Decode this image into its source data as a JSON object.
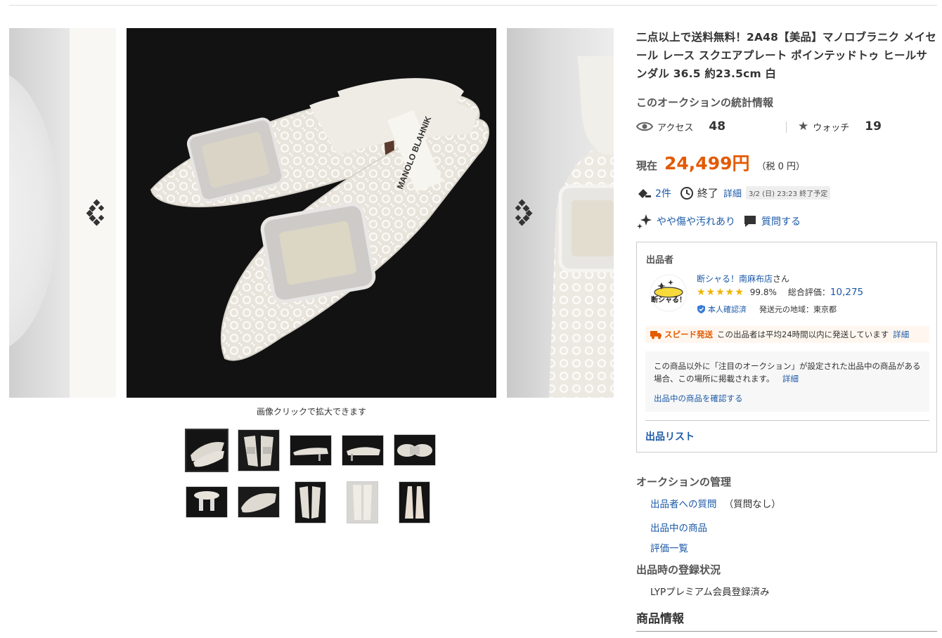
{
  "gallery": {
    "caption": "画像クリックで拡大できます",
    "prev_icon": "double-chevron-left-icon",
    "next_icon": "double-chevron-right-icon",
    "main_logo": "MANOLO BLAHNIK",
    "thumbnail_count": 10
  },
  "item": {
    "title": "二点以上で送料無料！2A48【美品】マノロブラニク メイセール レース スクエアプレート ポインテッドトゥ ヒールサンダル 36.5 約23.5cm 白"
  },
  "stats": {
    "heading": "このオークションの統計情報",
    "access_label": "アクセス",
    "access_value": "48",
    "watch_label": "ウォッチ",
    "watch_value": "19"
  },
  "price": {
    "label": "現在",
    "value": "24,499円",
    "tax": "（税 0 円）"
  },
  "bids": {
    "count": "2件",
    "end_label": "終了",
    "detail_link": "詳細",
    "end_time": "3/2 (日) 23:23 終了予定"
  },
  "condition": {
    "label": "やや傷や汚れあり",
    "question_link": "質問する"
  },
  "seller": {
    "heading": "出品者",
    "logo_text": "断シャる！",
    "name": "断シャる！南麻布店",
    "name_suffix": "さん",
    "stars": "★★★★★",
    "rating_pct": "99.8%",
    "total_label": "総合評価：",
    "total_value": "10,275",
    "verified": "本人確認済",
    "region": "発送元の地域：東京都",
    "speed_label": "スピード発送",
    "speed_text": "この出品者は平均24時間以内に発送しています",
    "speed_detail": "詳細",
    "notice_text": "この商品以外に「注目のオークション」が設定された出品中の商品がある場合、この場所に掲載されます。",
    "notice_detail": "詳細",
    "notice_confirm": "出品中の商品を確認する",
    "list_link": "出品リスト"
  },
  "management": {
    "heading": "オークションの管理",
    "question_link": "出品者への質問",
    "question_status": "（質問なし）",
    "listing_link": "出品中の商品",
    "ratings_link": "評価一覧"
  },
  "registration": {
    "heading": "出品時の登録状況",
    "value": "LYPプレミアム会員登録済み"
  },
  "product_info": {
    "heading": "商品情報"
  },
  "colors": {
    "accent_price": "#e35a00",
    "link": "#1c5aa8",
    "star": "#f0b400"
  }
}
